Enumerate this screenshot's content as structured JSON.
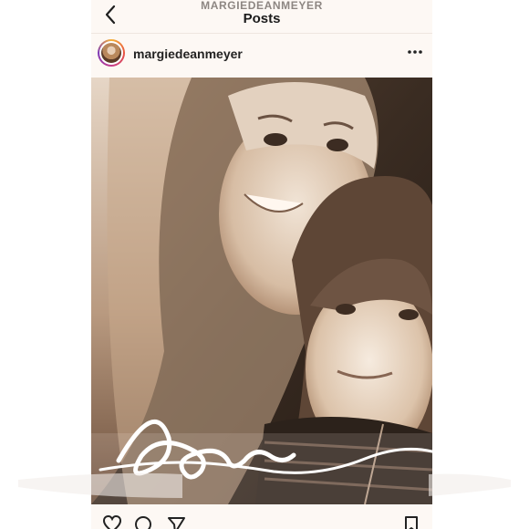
{
  "header": {
    "username": "MARGIEDEANMEYER",
    "title": "Posts"
  },
  "post": {
    "author": "margiedeanmeyer",
    "overlay_script": "love"
  },
  "icons": {
    "back": "chevron-left-icon",
    "more": "more-horizontal-icon",
    "like": "heart-icon",
    "comment": "comment-icon",
    "share": "send-icon",
    "save": "bookmark-icon"
  },
  "colors": {
    "background": "#fdf8f4",
    "sepia_dark": "#3a2c22",
    "sepia_light": "#d8c7b6"
  }
}
